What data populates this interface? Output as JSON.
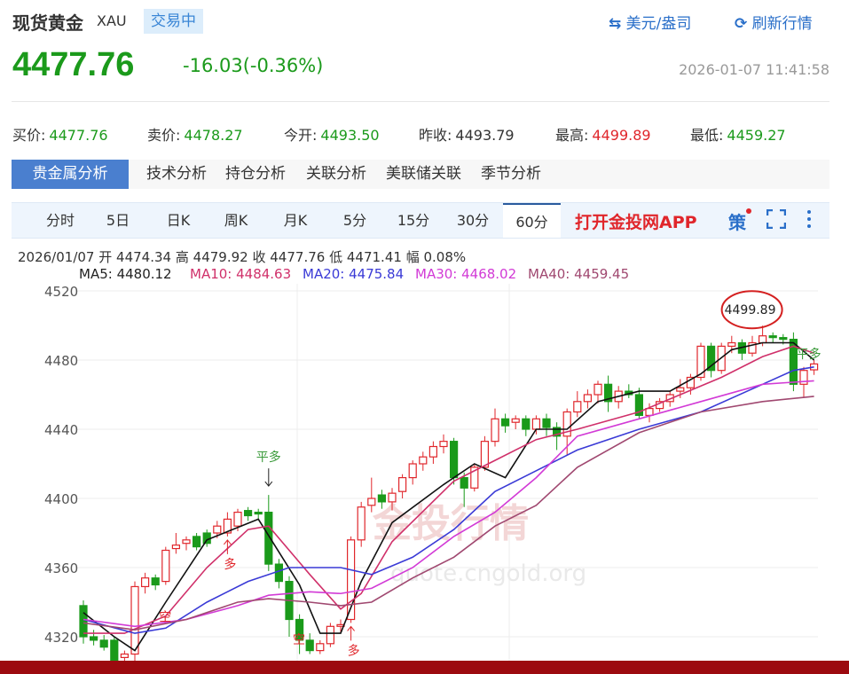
{
  "header": {
    "title": "现货黄金",
    "code": "XAU",
    "status": "交易中",
    "unit_link": "美元/盎司",
    "refresh_link": "刷新行情",
    "unit_icon": "swap-arrows-icon",
    "refresh_icon": "refresh-icon"
  },
  "quote": {
    "price": "4477.76",
    "change": "-16.03(-0.36%)",
    "timestamp": "2026-01-07 11:41:58",
    "stats": [
      {
        "label": "买价:",
        "value": "4477.76",
        "color": "green"
      },
      {
        "label": "卖价:",
        "value": "4478.27",
        "color": "green"
      },
      {
        "label": "今开:",
        "value": "4493.50",
        "color": "green"
      },
      {
        "label": "昨收:",
        "value": "4493.79",
        "color": "neutral"
      },
      {
        "label": "最高:",
        "value": "4499.89",
        "color": "red"
      },
      {
        "label": "最低:",
        "value": "4459.27",
        "color": "green"
      }
    ]
  },
  "tabs": [
    "贵金属分析",
    "技术分析",
    "持仓分析",
    "关联分析",
    "美联储关联",
    "季节分析"
  ],
  "periods": [
    "分时",
    "5日",
    "日K",
    "周K",
    "月K",
    "5分",
    "15分",
    "30分",
    "60分"
  ],
  "active_period": "60分",
  "app_link": "打开金投网APP",
  "strategy_icon_text": "策",
  "bar_info": {
    "date": "2026/01/07",
    "open_label": "开",
    "open": "4474.34",
    "high_label": "高",
    "high": "4479.92",
    "close_label": "收",
    "close": "4477.76",
    "low_label": "低",
    "low": "4471.41",
    "amp_label": "幅",
    "amp": "0.08%"
  },
  "ma_legend": [
    {
      "label": "MA5: 4480.12",
      "color": "#222222"
    },
    {
      "label": "MA10: 4484.63",
      "color": "#d0306a"
    },
    {
      "label": "MA20: 4475.84",
      "color": "#3a3ad6"
    },
    {
      "label": "MA30: 4468.02",
      "color": "#d23ad6"
    },
    {
      "label": "MA40: 4459.45",
      "color": "#a04870"
    }
  ],
  "watermark": {
    "text": "金投行情",
    "url": "quote.cngold.org"
  },
  "chart_data": {
    "type": "candlestick",
    "ylim": [
      4300,
      4524
    ],
    "yticks": [
      4320,
      4360,
      4400,
      4440,
      4480,
      4520
    ],
    "grid": true,
    "up_color": "#e0262b",
    "down_color": "#1a9a1a",
    "ohlc": [
      [
        4338,
        4341,
        4316,
        4320
      ],
      [
        4320,
        4324,
        4315,
        4318
      ],
      [
        4318,
        4321,
        4312,
        4314
      ],
      [
        4318,
        4320,
        4303,
        4306
      ],
      [
        4308,
        4312,
        4300,
        4310
      ],
      [
        4310,
        4352,
        4306,
        4349
      ],
      [
        4349,
        4357,
        4345,
        4354
      ],
      [
        4354,
        4356,
        4347,
        4350
      ],
      [
        4352,
        4372,
        4350,
        4370
      ],
      [
        4371,
        4380,
        4368,
        4373
      ],
      [
        4374,
        4378,
        4370,
        4376
      ],
      [
        4378,
        4380,
        4370,
        4372
      ],
      [
        4380,
        4382,
        4372,
        4374
      ],
      [
        4380,
        4387,
        4377,
        4384
      ],
      [
        4380,
        4392,
        4378,
        4388
      ],
      [
        4384,
        4394,
        4381,
        4392
      ],
      [
        4393,
        4395,
        4387,
        4390
      ],
      [
        4392,
        4394,
        4388,
        4391
      ],
      [
        4392,
        4402,
        4358,
        4362
      ],
      [
        4362,
        4365,
        4348,
        4352
      ],
      [
        4352,
        4355,
        4320,
        4330
      ],
      [
        4330,
        4333,
        4310,
        4318
      ],
      [
        4318,
        4322,
        4310,
        4312
      ],
      [
        4312,
        4318,
        4310,
        4316
      ],
      [
        4316,
        4328,
        4314,
        4326
      ],
      [
        4326,
        4330,
        4322,
        4327
      ],
      [
        4330,
        4378,
        4328,
        4376
      ],
      [
        4376,
        4398,
        4372,
        4395
      ],
      [
        4396,
        4412,
        4392,
        4400
      ],
      [
        4402,
        4405,
        4394,
        4398
      ],
      [
        4398,
        4406,
        4393,
        4403
      ],
      [
        4404,
        4414,
        4400,
        4412
      ],
      [
        4412,
        4422,
        4408,
        4420
      ],
      [
        4420,
        4427,
        4416,
        4424
      ],
      [
        4424,
        4433,
        4420,
        4430
      ],
      [
        4430,
        4437,
        4426,
        4433
      ],
      [
        4433,
        4435,
        4408,
        4412
      ],
      [
        4412,
        4415,
        4395,
        4406
      ],
      [
        4406,
        4420,
        4404,
        4418
      ],
      [
        4418,
        4436,
        4416,
        4433
      ],
      [
        4433,
        4452,
        4430,
        4446
      ],
      [
        4446,
        4449,
        4438,
        4442
      ],
      [
        4444,
        4448,
        4440,
        4446
      ],
      [
        4446,
        4448,
        4436,
        4440
      ],
      [
        4440,
        4448,
        4437,
        4446
      ],
      [
        4446,
        4449,
        4436,
        4441
      ],
      [
        4441,
        4444,
        4428,
        4436
      ],
      [
        4436,
        4452,
        4425,
        4450
      ],
      [
        4450,
        4462,
        4447,
        4456
      ],
      [
        4456,
        4463,
        4452,
        4460
      ],
      [
        4460,
        4468,
        4455,
        4466
      ],
      [
        4466,
        4471,
        4450,
        4456
      ],
      [
        4456,
        4465,
        4452,
        4462
      ],
      [
        4462,
        4466,
        4458,
        4460
      ],
      [
        4460,
        4464,
        4446,
        4448
      ],
      [
        4448,
        4455,
        4444,
        4452
      ],
      [
        4452,
        4458,
        4450,
        4456
      ],
      [
        4456,
        4462,
        4453,
        4460
      ],
      [
        4462,
        4469,
        4458,
        4464
      ],
      [
        4464,
        4472,
        4460,
        4470
      ],
      [
        4470,
        4490,
        4468,
        4488
      ],
      [
        4488,
        4490,
        4470,
        4474
      ],
      [
        4474,
        4490,
        4472,
        4488
      ],
      [
        4488,
        4494,
        4484,
        4490
      ],
      [
        4490,
        4492,
        4480,
        4484
      ],
      [
        4484,
        4494,
        4482,
        4490
      ],
      [
        4490,
        4499.89,
        4488,
        4494
      ],
      [
        4494,
        4496,
        4490,
        4493
      ],
      [
        4493,
        4495,
        4489,
        4492
      ],
      [
        4492,
        4496,
        4462,
        4466
      ],
      [
        4466,
        4476,
        4458,
        4474
      ],
      [
        4474.34,
        4479.92,
        4471.41,
        4477.76
      ]
    ],
    "ma_series": [
      {
        "name": "MA5",
        "color": "#111111",
        "points": [
          [
            0,
            4334
          ],
          [
            3,
            4320
          ],
          [
            5,
            4312
          ],
          [
            8,
            4340
          ],
          [
            12,
            4376
          ],
          [
            17,
            4388
          ],
          [
            21,
            4350
          ],
          [
            23,
            4322
          ],
          [
            25,
            4322
          ],
          [
            27,
            4352
          ],
          [
            30,
            4386
          ],
          [
            35,
            4408
          ],
          [
            38,
            4420
          ],
          [
            41,
            4412
          ],
          [
            44,
            4440
          ],
          [
            47,
            4440
          ],
          [
            50,
            4456
          ],
          [
            54,
            4462
          ],
          [
            57,
            4462
          ],
          [
            60,
            4472
          ],
          [
            63,
            4486
          ],
          [
            66,
            4490
          ],
          [
            69,
            4490
          ],
          [
            71,
            4480
          ]
        ]
      },
      {
        "name": "MA10",
        "color": "#d0306a",
        "points": [
          [
            0,
            4322
          ],
          [
            4,
            4322
          ],
          [
            8,
            4332
          ],
          [
            12,
            4360
          ],
          [
            16,
            4382
          ],
          [
            18,
            4384
          ],
          [
            22,
            4356
          ],
          [
            25,
            4336
          ],
          [
            27,
            4345
          ],
          [
            30,
            4375
          ],
          [
            36,
            4410
          ],
          [
            40,
            4422
          ],
          [
            44,
            4434
          ],
          [
            48,
            4440
          ],
          [
            54,
            4450
          ],
          [
            58,
            4460
          ],
          [
            62,
            4470
          ],
          [
            66,
            4482
          ],
          [
            69,
            4488
          ],
          [
            71,
            4484
          ]
        ]
      },
      {
        "name": "MA20",
        "color": "#3a3ad6",
        "points": [
          [
            0,
            4330
          ],
          [
            5,
            4322
          ],
          [
            8,
            4325
          ],
          [
            12,
            4340
          ],
          [
            16,
            4352
          ],
          [
            20,
            4360
          ],
          [
            25,
            4360
          ],
          [
            28,
            4356
          ],
          [
            32,
            4366
          ],
          [
            36,
            4382
          ],
          [
            40,
            4404
          ],
          [
            44,
            4416
          ],
          [
            48,
            4428
          ],
          [
            54,
            4440
          ],
          [
            60,
            4450
          ],
          [
            66,
            4466
          ],
          [
            69,
            4474
          ],
          [
            71,
            4476
          ]
        ]
      },
      {
        "name": "MA30",
        "color": "#d23ad6",
        "points": [
          [
            0,
            4330
          ],
          [
            5,
            4326
          ],
          [
            10,
            4330
          ],
          [
            15,
            4338
          ],
          [
            18,
            4344
          ],
          [
            22,
            4346
          ],
          [
            25,
            4345
          ],
          [
            28,
            4348
          ],
          [
            32,
            4360
          ],
          [
            36,
            4378
          ],
          [
            40,
            4392
          ],
          [
            44,
            4412
          ],
          [
            48,
            4436
          ],
          [
            54,
            4446
          ],
          [
            60,
            4456
          ],
          [
            66,
            4466
          ],
          [
            71,
            4468
          ]
        ]
      },
      {
        "name": "MA40",
        "color": "#a04870",
        "points": [
          [
            0,
            4328
          ],
          [
            5,
            4324
          ],
          [
            10,
            4330
          ],
          [
            15,
            4340
          ],
          [
            18,
            4342
          ],
          [
            22,
            4340
          ],
          [
            25,
            4338
          ],
          [
            28,
            4340
          ],
          [
            32,
            4354
          ],
          [
            36,
            4366
          ],
          [
            40,
            4384
          ],
          [
            44,
            4396
          ],
          [
            48,
            4418
          ],
          [
            54,
            4438
          ],
          [
            60,
            4450
          ],
          [
            66,
            4456
          ],
          [
            71,
            4459
          ]
        ]
      }
    ],
    "annotations": [
      {
        "index": 66,
        "text": "4499.89",
        "type": "max-circle"
      },
      {
        "index": 18,
        "text": "平多",
        "type": "signal-down"
      },
      {
        "index": 71,
        "text": "平多",
        "type": "signal"
      },
      {
        "index": 14,
        "text": "多",
        "type": "signal-up"
      },
      {
        "index": 26,
        "text": "多",
        "type": "signal-up"
      },
      {
        "index": 7,
        "text": "空",
        "type": "signal"
      },
      {
        "index": 20,
        "text": "空",
        "type": "signal"
      }
    ]
  }
}
